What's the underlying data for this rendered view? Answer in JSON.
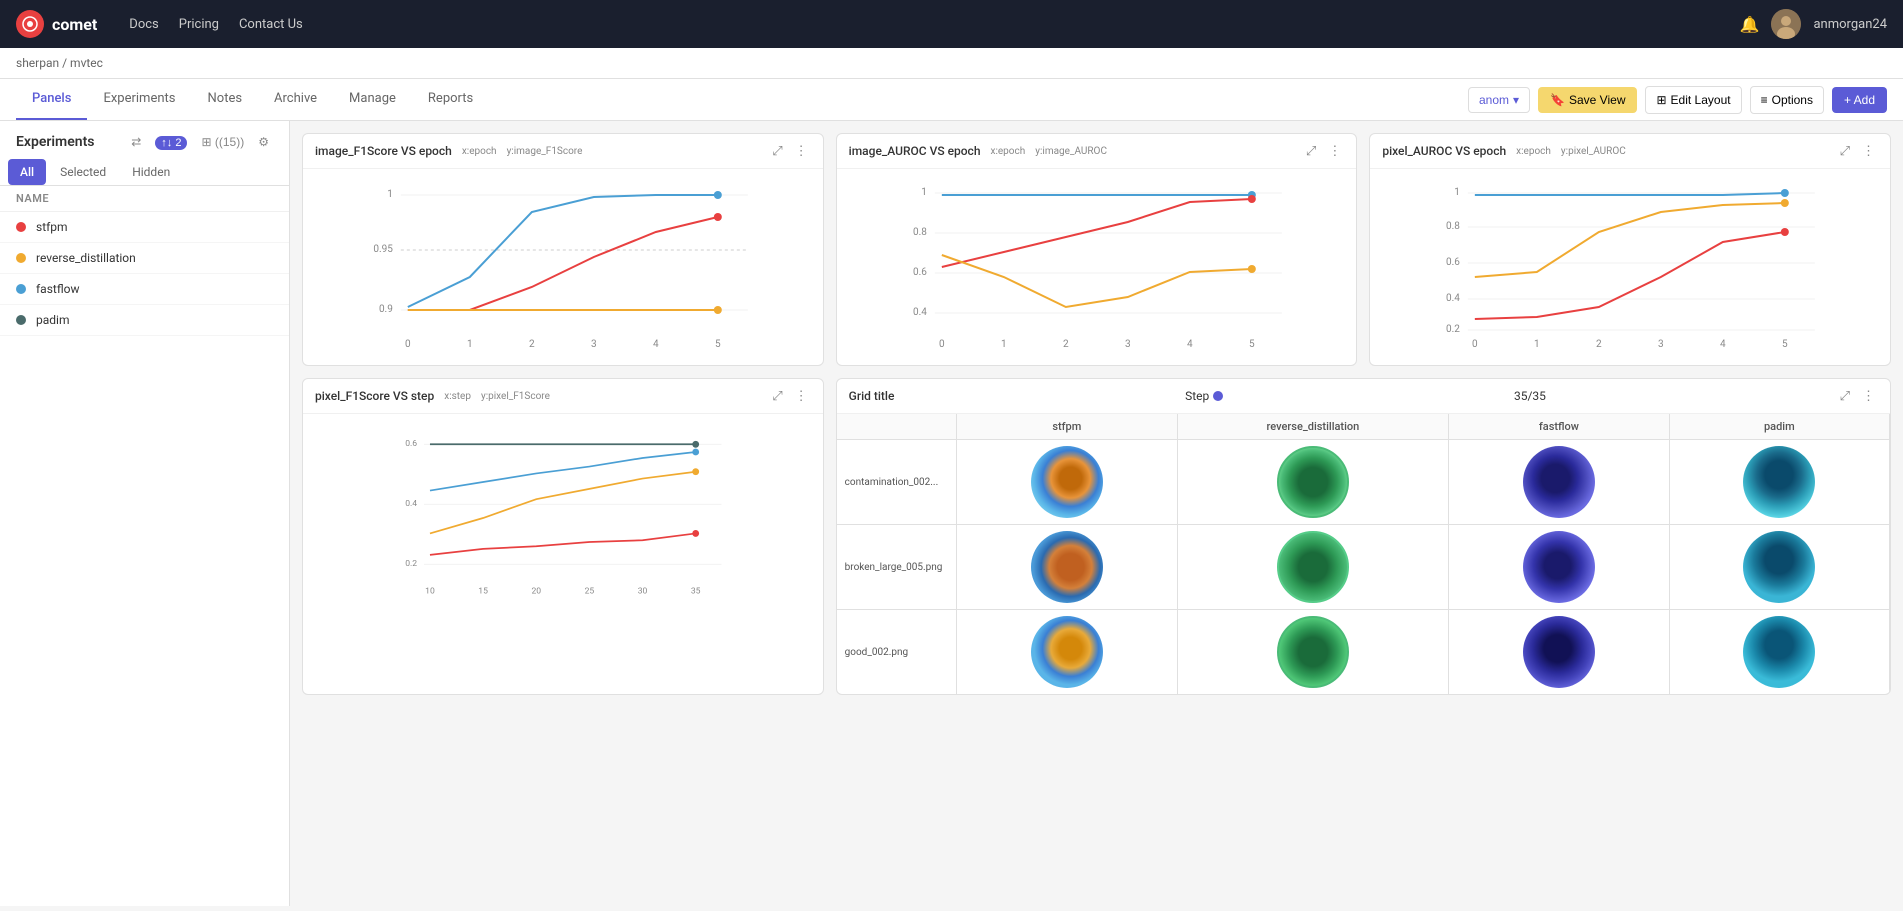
{
  "topnav": {
    "logo_text": "comet",
    "links": [
      {
        "label": "Docs",
        "href": "#"
      },
      {
        "label": "Pricing",
        "href": "#"
      },
      {
        "label": "Contact Us",
        "href": "#"
      }
    ],
    "username": "anmorgan24"
  },
  "breadcrumb": {
    "workspace": "sherpan",
    "separator": "/",
    "project": "mvtec"
  },
  "tabs": [
    {
      "label": "Panels",
      "active": true
    },
    {
      "label": "Experiments",
      "active": false
    },
    {
      "label": "Notes",
      "active": false
    },
    {
      "label": "Archive",
      "active": false
    },
    {
      "label": "Manage",
      "active": false
    },
    {
      "label": "Reports",
      "active": false
    }
  ],
  "toolbar": {
    "user_dropdown": "anom",
    "save_view_label": "Save View",
    "edit_layout_label": "Edit Layout",
    "options_label": "Options",
    "add_label": "+ Add"
  },
  "sidebar": {
    "title": "Experiments",
    "filter_count": "2",
    "count_label": "(15)",
    "tabs": [
      "All",
      "Selected",
      "Hidden"
    ],
    "active_tab": "All",
    "col_header": "NAME",
    "experiments": [
      {
        "name": "stfpm",
        "color": "#e84040"
      },
      {
        "name": "reverse_distillation",
        "color": "#f0aa30"
      },
      {
        "name": "fastflow",
        "color": "#4a9fd4"
      },
      {
        "name": "padim",
        "color": "#4a6b6b"
      }
    ]
  },
  "chart1": {
    "title": "image_F1Score VS epoch",
    "x_label": "x:epoch",
    "y_label": "y:image_F1Score",
    "y_axis": [
      1,
      0.95,
      0.9
    ],
    "x_axis": [
      0,
      1,
      2,
      3,
      4,
      5
    ]
  },
  "chart2": {
    "title": "image_AUROC VS epoch",
    "x_label": "x:epoch",
    "y_label": "y:image_AUROC",
    "y_axis": [
      1,
      0.8,
      0.6,
      0.4
    ],
    "x_axis": [
      0,
      1,
      2,
      3,
      4,
      5
    ]
  },
  "chart3": {
    "title": "pixel_AUROC VS epoch",
    "x_label": "x:epoch",
    "y_label": "y:pixel_AUROC",
    "y_axis": [
      1,
      0.8,
      0.6,
      0.4,
      0.2
    ],
    "x_axis": [
      0,
      1,
      2,
      3,
      4,
      5
    ]
  },
  "chart4": {
    "title": "pixel_F1Score VS step",
    "x_label": "x:step",
    "y_label": "y:pixel_F1Score",
    "y_axis": [
      0.6,
      0.4,
      0.2
    ],
    "x_axis": [
      10,
      15,
      20,
      25,
      30,
      35
    ]
  },
  "grid": {
    "title": "Grid title",
    "step_label": "Step",
    "count": "35/35",
    "columns": [
      "stfpm",
      "reverse_distillation",
      "fastflow",
      "padim"
    ],
    "rows": [
      {
        "label": "contamination_002..."
      },
      {
        "label": "broken_large_005.png"
      },
      {
        "label": "good_002.png"
      }
    ]
  }
}
